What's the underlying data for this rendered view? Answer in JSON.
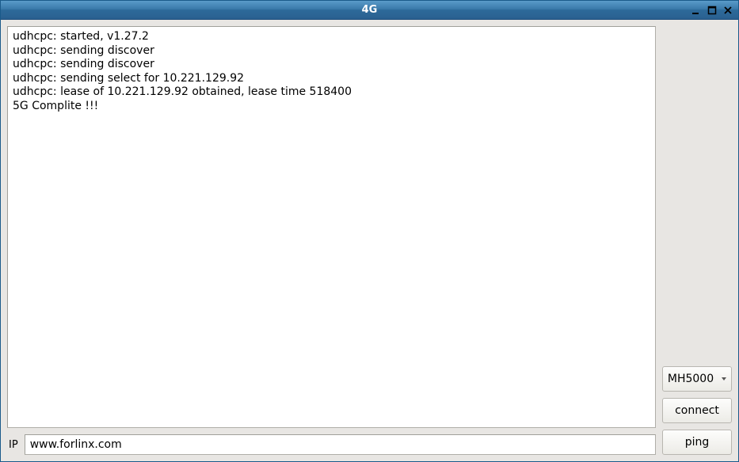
{
  "window": {
    "title": "4G"
  },
  "log": {
    "lines": [
      "udhcpc: started, v1.27.2",
      "udhcpc: sending discover",
      "udhcpc: sending discover",
      "udhcpc: sending select for 10.221.129.92",
      "udhcpc: lease of 10.221.129.92 obtained, lease time 518400",
      "5G Complite !!!"
    ]
  },
  "ip": {
    "label": "IP",
    "value": "www.forlinx.com"
  },
  "controls": {
    "module_select": {
      "selected": "MH5000"
    },
    "connect_label": "connect",
    "ping_label": "ping"
  }
}
